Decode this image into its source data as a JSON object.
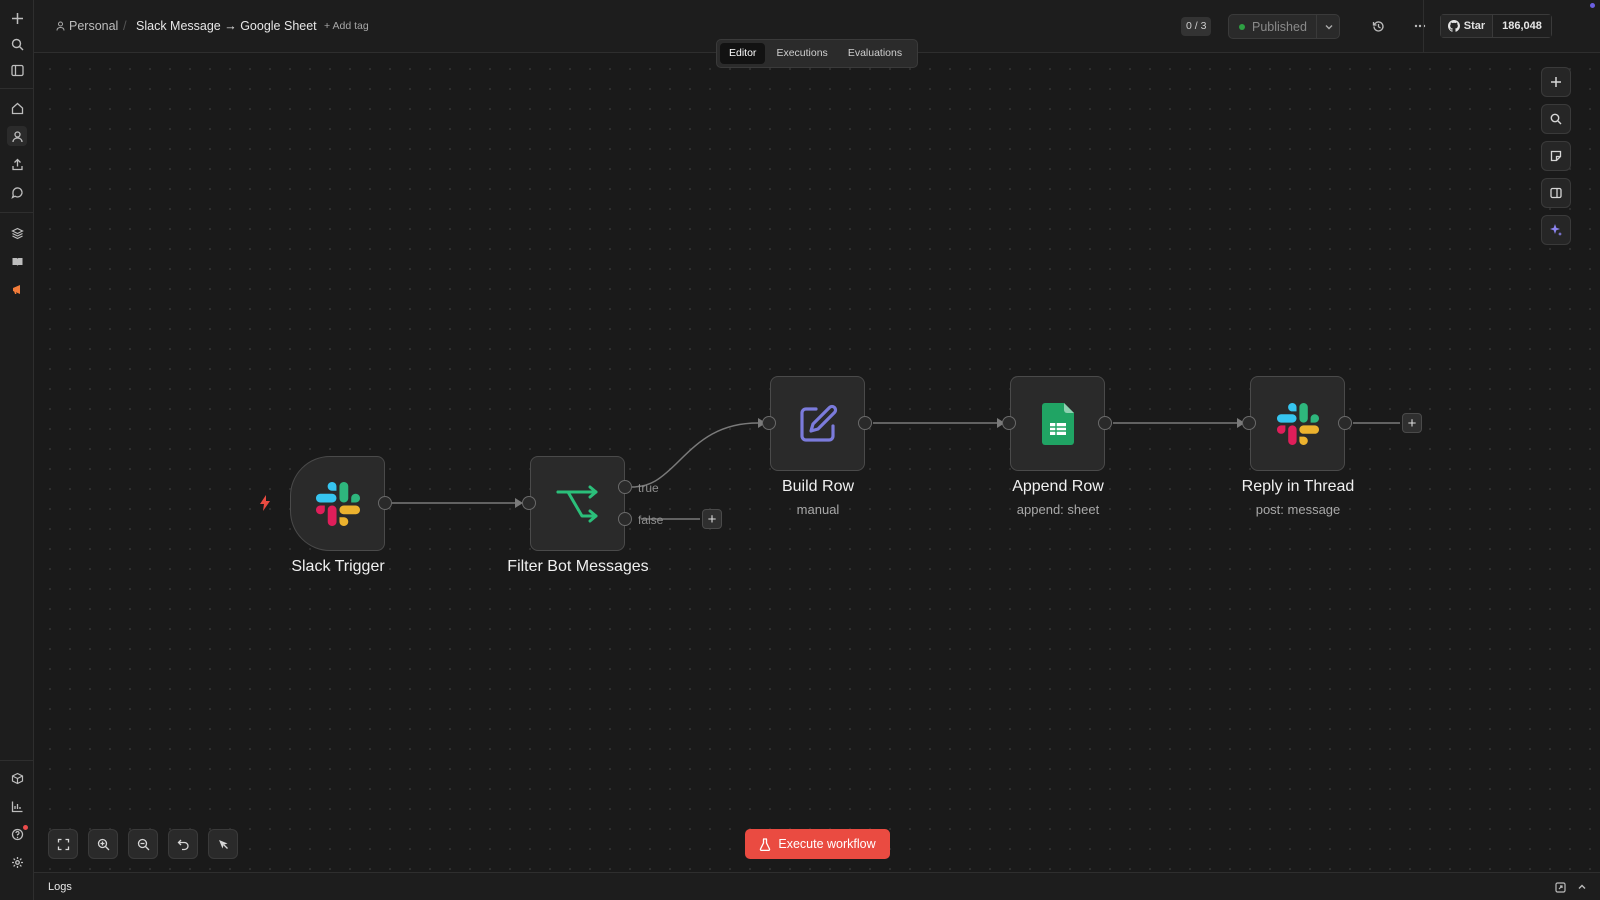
{
  "breadcrumb": {
    "project": "Personal",
    "separator": "/"
  },
  "workflow": {
    "title": "Slack Message → Google Sheet",
    "add_tag": "+ Add tag"
  },
  "header": {
    "counter": "0 / 3",
    "status": "Published",
    "github": {
      "star_label": "Star",
      "star_count": "186,048"
    }
  },
  "tabs": [
    {
      "label": "Editor",
      "active": true
    },
    {
      "label": "Executions",
      "active": false
    },
    {
      "label": "Evaluations",
      "active": false
    }
  ],
  "nodes": [
    {
      "id": "slack-trigger",
      "label": "Slack Trigger",
      "subtitle": "",
      "icon": "slack-icon"
    },
    {
      "id": "filter-bot-messages",
      "label": "Filter Bot Messages",
      "subtitle": "",
      "icon": "if-branch-icon",
      "branches": [
        "true",
        "false"
      ]
    },
    {
      "id": "build-row",
      "label": "Build Row",
      "subtitle": "manual",
      "icon": "edit-icon"
    },
    {
      "id": "append-row",
      "label": "Append Row",
      "subtitle": "append: sheet",
      "icon": "google-sheets-icon"
    },
    {
      "id": "reply-in-thread",
      "label": "Reply in Thread",
      "subtitle": "post: message",
      "icon": "slack-icon"
    }
  ],
  "connections": [
    [
      "slack-trigger",
      "filter-bot-messages"
    ],
    [
      "filter-bot-messages:true",
      "build-row"
    ],
    [
      "build-row",
      "append-row"
    ],
    [
      "append-row",
      "reply-in-thread"
    ]
  ],
  "actions": {
    "execute": "Execute workflow"
  },
  "logs": {
    "label": "Logs"
  },
  "colors": {
    "background": "#1a1a1a",
    "accent": "#ea4b41",
    "published_dot": "#2ea043",
    "sheets_green": "#20a464",
    "edit_purple": "#7b7bdb"
  }
}
